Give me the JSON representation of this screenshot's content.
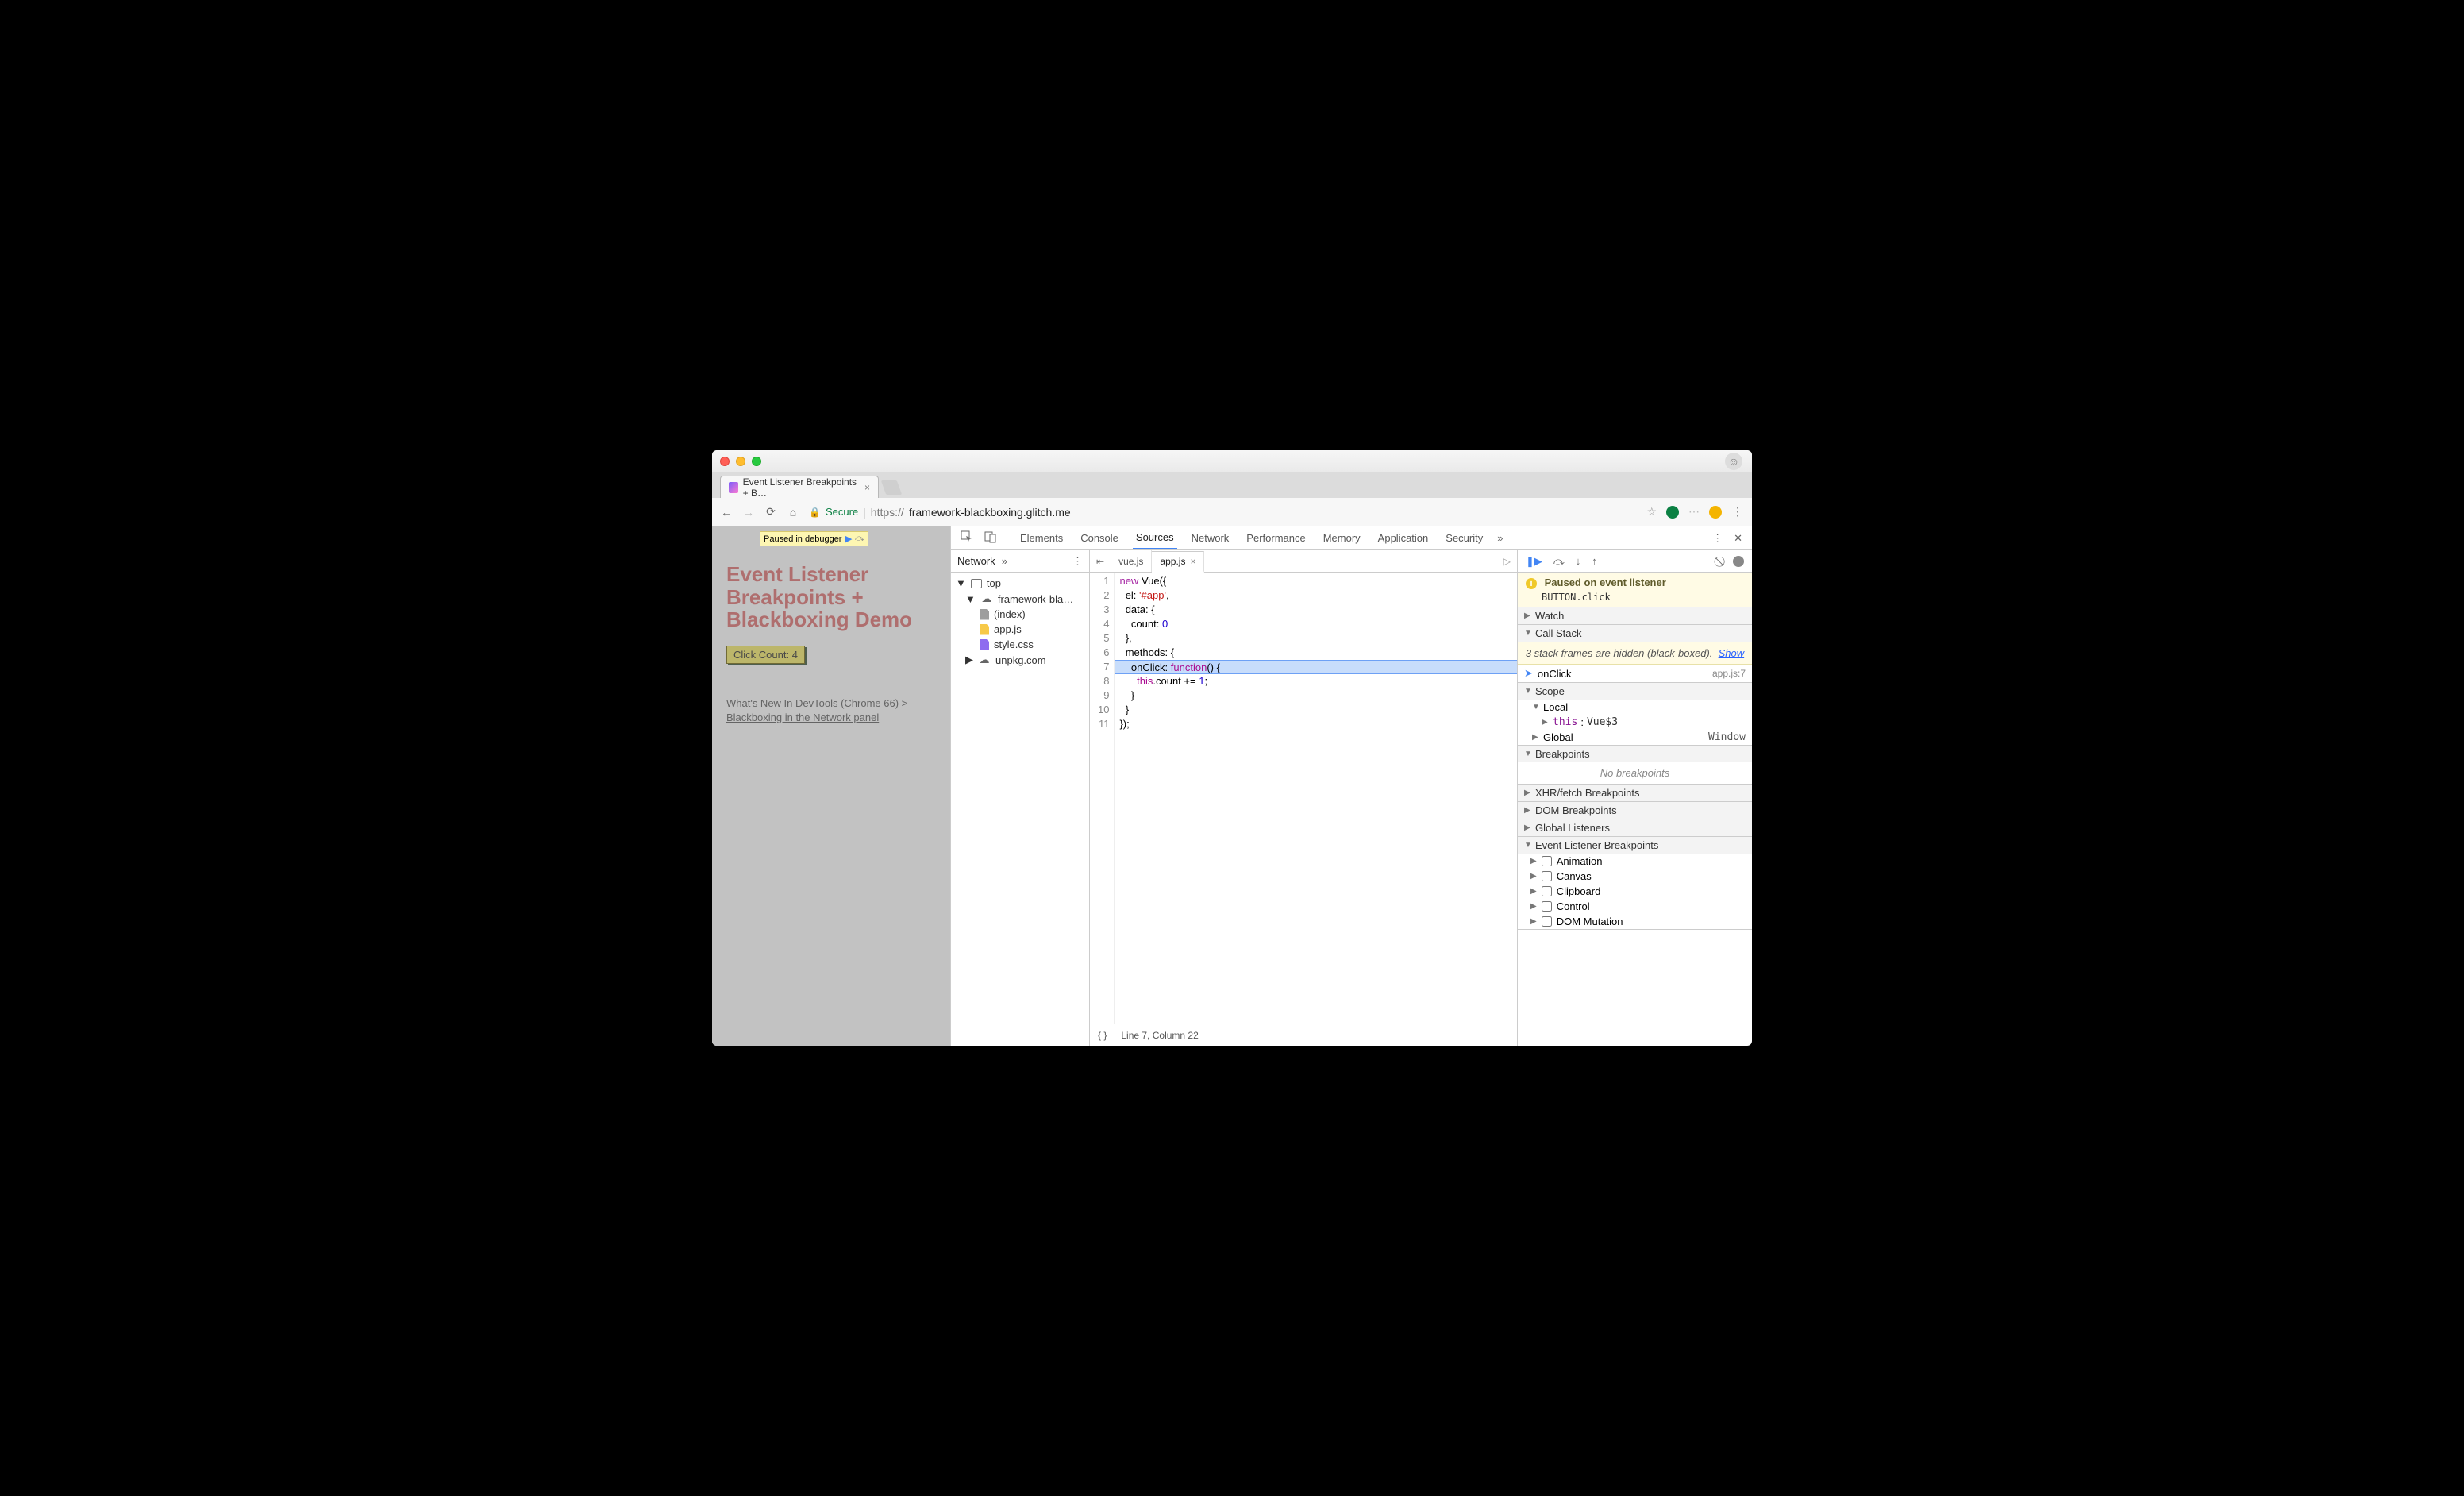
{
  "browser": {
    "tab_title": "Event Listener Breakpoints + B…",
    "secure_label": "Secure",
    "url_scheme": "https://",
    "url_host": "framework-blackboxing.glitch.me"
  },
  "page": {
    "paused_badge": "Paused in debugger",
    "heading": "Event Listener Breakpoints + Blackboxing Demo",
    "button_label": "Click Count: 4",
    "link_text": "What's New In DevTools (Chrome 66) > Blackboxing in the Network panel"
  },
  "devtools": {
    "tabs": [
      "Elements",
      "Console",
      "Sources",
      "Network",
      "Performance",
      "Memory",
      "Application",
      "Security"
    ],
    "active_tab": "Sources",
    "nav": {
      "sub_tab": "Network",
      "tree_top": "top",
      "domain": "framework-bla…",
      "files": [
        "(index)",
        "app.js",
        "style.css"
      ],
      "ext_domain": "unpkg.com"
    },
    "editor": {
      "open_tabs": [
        "vue.js",
        "app.js"
      ],
      "active": "app.js",
      "status": "Line 7, Column 22",
      "code_lines": [
        "new Vue({",
        "  el: '#app',",
        "  data: {",
        "    count: 0",
        "  },",
        "  methods: {",
        "    onClick: function() {",
        "      this.count += 1;",
        "    }",
        "  }",
        "});"
      ]
    },
    "debugger": {
      "paused_title": "Paused on event listener",
      "paused_target": "BUTTON.click",
      "sections": {
        "watch": "Watch",
        "call_stack": "Call Stack",
        "blackbox_note_a": "3 stack frames are hidden (black-boxed).",
        "blackbox_show": "Show",
        "stack_fn": "onClick",
        "stack_loc": "app.js:7",
        "scope": "Scope",
        "scope_local": "Local",
        "scope_this_k": "this",
        "scope_this_v": "Vue$3",
        "scope_global": "Global",
        "scope_global_v": "Window",
        "breakpoints": "Breakpoints",
        "no_bp": "No breakpoints",
        "xhr": "XHR/fetch Breakpoints",
        "dom": "DOM Breakpoints",
        "gl": "Global Listeners",
        "elb": "Event Listener Breakpoints",
        "elb_items": [
          "Animation",
          "Canvas",
          "Clipboard",
          "Control",
          "DOM Mutation"
        ]
      }
    }
  }
}
